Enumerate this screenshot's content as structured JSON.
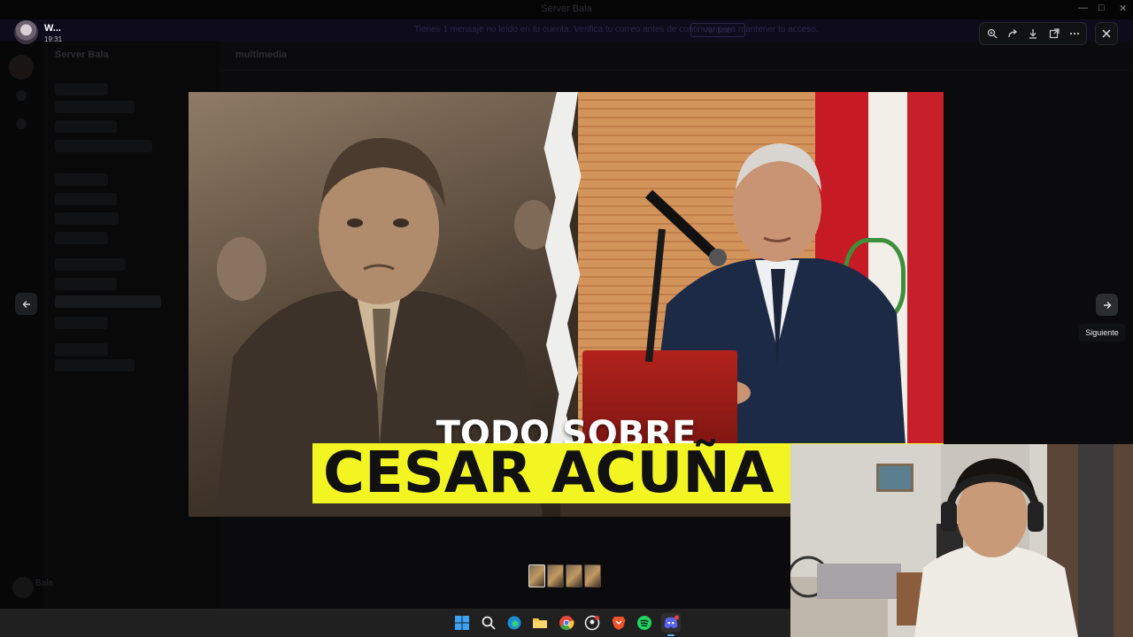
{
  "window": {
    "title": "Server Bala"
  },
  "background": {
    "banner_text": "Tienes 1 mensaje no leído en tu cuenta. Verifica tu correo antes de continuar para mantener tu acceso.",
    "banner_button": "Verificar",
    "server_name": "Server Bala",
    "channel_name": "multimedia",
    "user_name": "Bala"
  },
  "viewer": {
    "uploader_name": "W...",
    "uploader_time": "19:31",
    "toolbar_icons": [
      "zoom-in-icon",
      "forward-icon",
      "download-icon",
      "open-external-icon",
      "more-icon"
    ],
    "close_icon": "close-icon",
    "prev_icon": "arrow-left-icon",
    "next_icon": "arrow-right-icon",
    "next_tooltip": "Siguiente"
  },
  "image": {
    "headline_top": "TODO SOBRE",
    "headline_bottom": "CESAR ACUÑA",
    "highlight_color": "#f3f523"
  },
  "thumbnails": {
    "count": 4,
    "active_index": 0
  },
  "taskbar": {
    "icons": [
      "windows-start-icon",
      "search-icon",
      "edge-icon",
      "file-explorer-icon",
      "chrome-icon",
      "github-icon",
      "brave-icon",
      "spotify-icon",
      "discord-icon"
    ],
    "active": "discord-icon"
  }
}
